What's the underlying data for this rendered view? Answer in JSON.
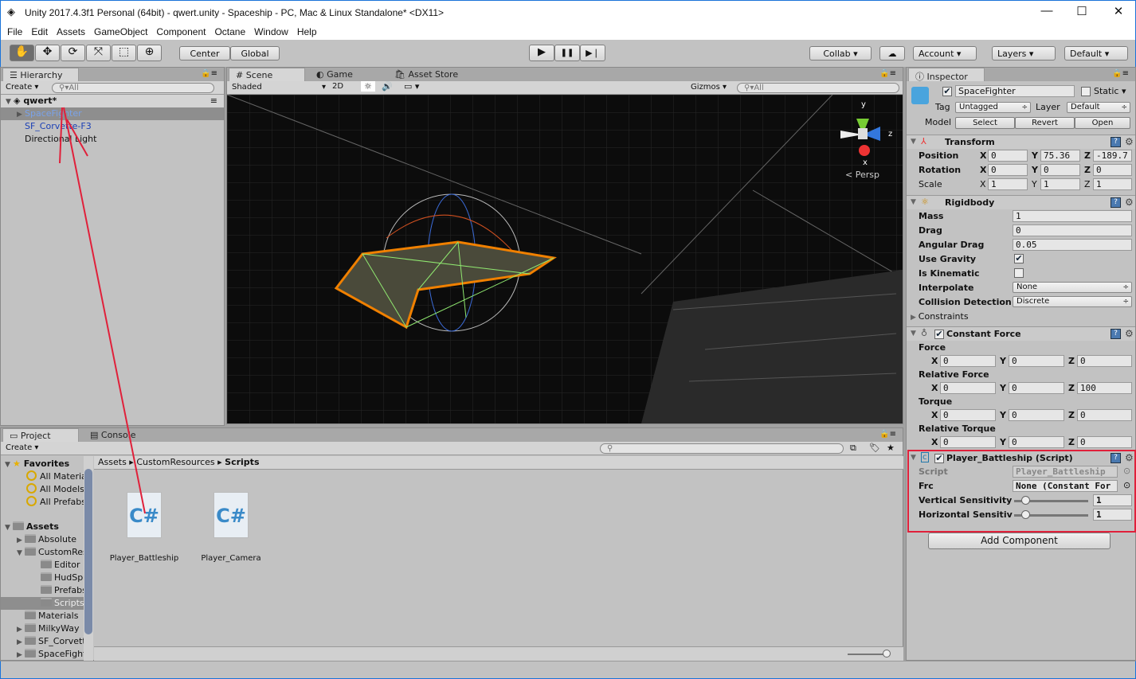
{
  "window": {
    "title": "Unity 2017.4.3f1 Personal (64bit) - qwert.unity - Spaceship - PC, Mac & Linux Standalone* <DX11>",
    "minimize": "—",
    "maximize": "☐",
    "close": "✕"
  },
  "menu": [
    "File",
    "Edit",
    "Assets",
    "GameObject",
    "Component",
    "Octane",
    "Window",
    "Help"
  ],
  "toolbar": {
    "tools": [
      "hand-icon",
      "move-icon",
      "rotate-icon",
      "scale-icon",
      "rect-icon",
      "transform-icon"
    ],
    "tool_glyphs": [
      "✋",
      "✥",
      "⟳",
      "⤧",
      "⬚",
      "⊕"
    ],
    "center": "Center",
    "global": "Global",
    "play": "▶",
    "pause": "❚❚",
    "step": "▶❘",
    "collab": "Collab ▾",
    "cloud": "☁",
    "account": "Account",
    "layers": "Layers",
    "layout": "Default"
  },
  "hierarchy": {
    "tab": "Hierarchy",
    "create": "Create",
    "search": "All",
    "scene": "qwert*",
    "items": [
      "SpaceFighter",
      "SF_Corvette-F3",
      "Directional Light"
    ]
  },
  "scene": {
    "tabs": [
      "Scene",
      "Game",
      "Asset Store"
    ],
    "shading": "Shaded",
    "mode2d": "2D",
    "gizmos": "Gizmos",
    "search": "All",
    "persp": "Persp",
    "axes": {
      "y": "y",
      "z": "z",
      "x": "x"
    }
  },
  "inspector": {
    "tab": "Inspector",
    "name": "SpaceFighter",
    "static": "Static",
    "tag_label": "Tag",
    "tag": "Untagged",
    "layer_label": "Layer",
    "layer": "Default",
    "model_label": "Model",
    "select": "Select",
    "revert": "Revert",
    "open": "Open",
    "transform": {
      "title": "Transform",
      "rows": [
        {
          "label": "Position",
          "x": "0",
          "y": "75.36",
          "z": "-189.7"
        },
        {
          "label": "Rotation",
          "x": "0",
          "y": "0",
          "z": "0"
        },
        {
          "label": "Scale",
          "x": "1",
          "y": "1",
          "z": "1"
        }
      ]
    },
    "rigidbody": {
      "title": "Rigidbody",
      "mass_l": "Mass",
      "mass": "1",
      "drag_l": "Drag",
      "drag": "0",
      "adrag_l": "Angular Drag",
      "adrag": "0.05",
      "grav_l": "Use Gravity",
      "use_gravity": true,
      "kin_l": "Is Kinematic",
      "is_kinematic": false,
      "interp_l": "Interpolate",
      "interp": "None",
      "coll_l": "Collision Detection",
      "coll": "Discrete",
      "cons_l": "Constraints"
    },
    "constant_force": {
      "title": "Constant Force",
      "groups": [
        {
          "label": "Force",
          "x": "0",
          "y": "0",
          "z": "0"
        },
        {
          "label": "Relative Force",
          "x": "0",
          "y": "0",
          "z": "100"
        },
        {
          "label": "Torque",
          "x": "0",
          "y": "0",
          "z": "0"
        },
        {
          "label": "Relative Torque",
          "x": "0",
          "y": "0",
          "z": "0"
        }
      ]
    },
    "script": {
      "title": "Player_Battleship (Script)",
      "script_l": "Script",
      "script": "Player_Battleship",
      "frc_l": "Frc",
      "frc": "None (Constant For",
      "vs_l": "Vertical Sensitivity",
      "vs": "1",
      "hs_l": "Horizontal Sensitivity",
      "hs": "1",
      "vs_slider": 0.1,
      "hs_slider": 0.1
    },
    "add_component": "Add Component",
    "highlight_color": "#e0203a"
  },
  "project": {
    "tabs": [
      "Project",
      "Console"
    ],
    "create": "Create",
    "favorites": "Favorites",
    "fav_items": [
      "All Materials",
      "All Models",
      "All Prefabs"
    ],
    "assets": "Assets",
    "folders": [
      {
        "name": "Absolute",
        "indent": 1,
        "exp": "▶"
      },
      {
        "name": "CustomResources",
        "indent": 1,
        "exp": "▼"
      },
      {
        "name": "Editor",
        "indent": 2,
        "exp": ""
      },
      {
        "name": "HudSprites",
        "indent": 2,
        "exp": ""
      },
      {
        "name": "Prefabs",
        "indent": 2,
        "exp": ""
      },
      {
        "name": "Scripts",
        "indent": 2,
        "exp": "",
        "selected": true
      },
      {
        "name": "Materials",
        "indent": 1,
        "exp": ""
      },
      {
        "name": "MilkyWay",
        "indent": 1,
        "exp": "▶"
      },
      {
        "name": "SF_Corvette",
        "indent": 1,
        "exp": "▶"
      },
      {
        "name": "SpaceFighter",
        "indent": 1,
        "exp": "▶"
      }
    ],
    "breadcrumb": [
      "Assets",
      "CustomResources",
      "Scripts"
    ],
    "files": [
      "Player_Battleship",
      "Player_Camera"
    ],
    "file_glyph": "C#"
  }
}
